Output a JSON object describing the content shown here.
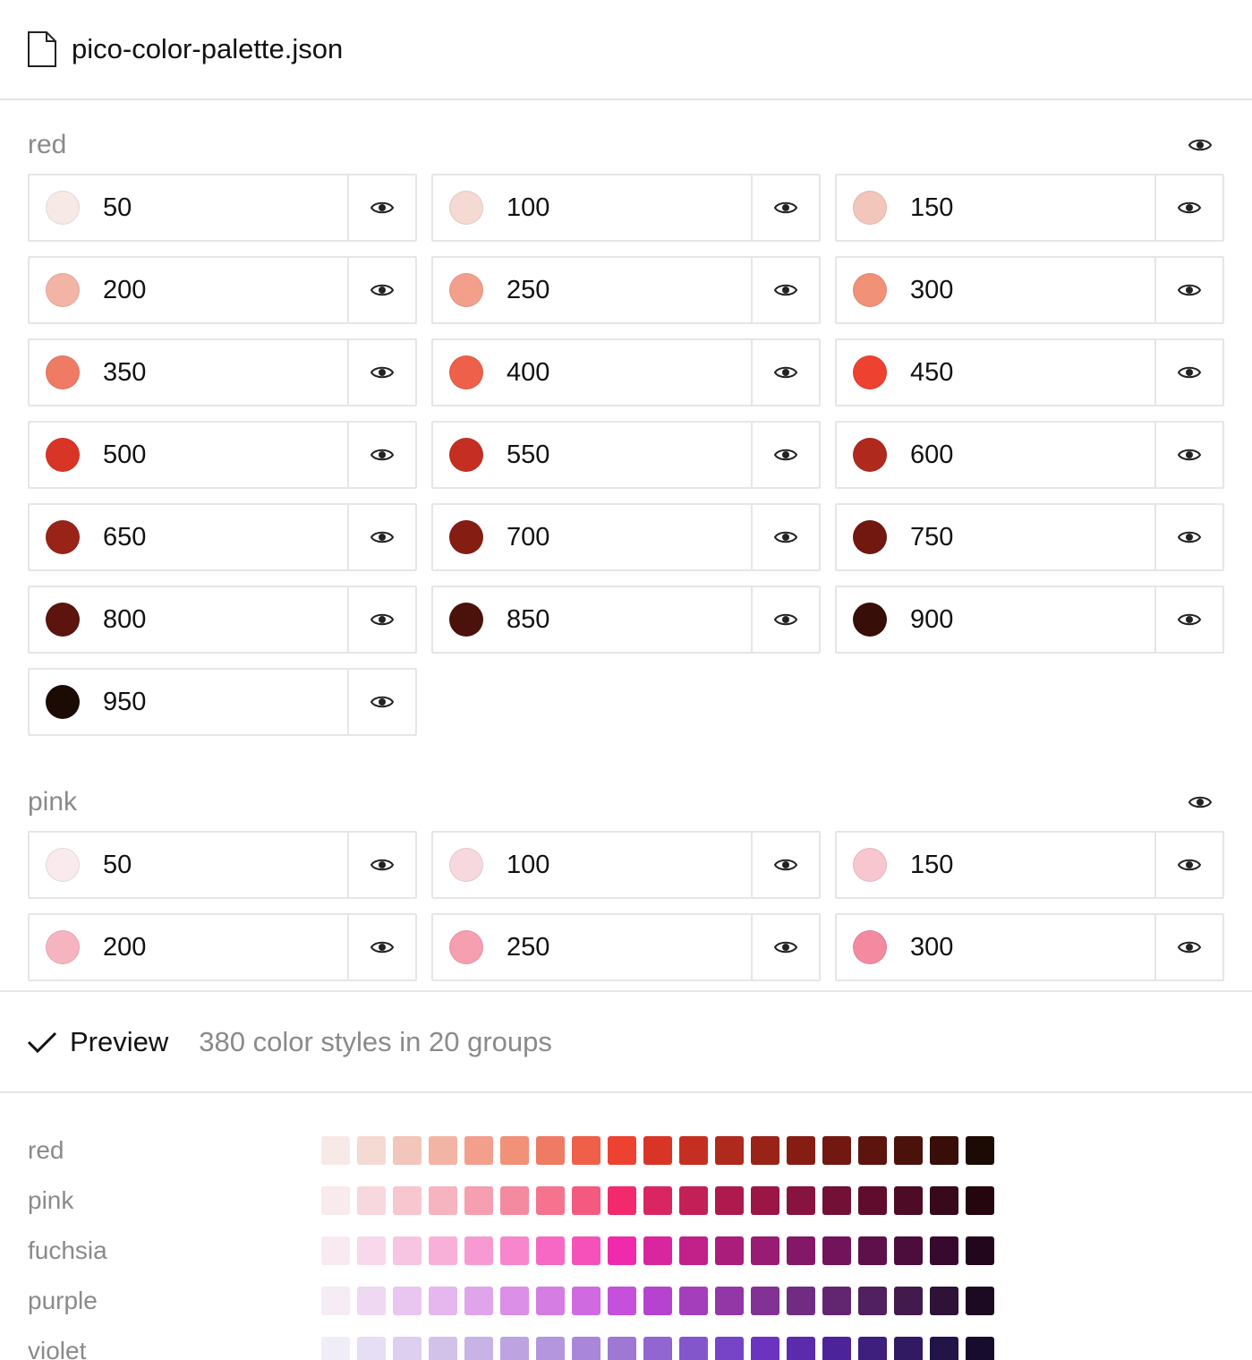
{
  "header": {
    "filename": "pico-color-palette.json",
    "icon": "file-icon"
  },
  "groups": [
    {
      "name": "red",
      "items": [
        {
          "label": "50",
          "color": "#f7eae6"
        },
        {
          "label": "100",
          "color": "#f5dad3"
        },
        {
          "label": "150",
          "color": "#f3c6bb"
        },
        {
          "label": "200",
          "color": "#f2b4a4"
        },
        {
          "label": "250",
          "color": "#f39f8b"
        },
        {
          "label": "300",
          "color": "#f19178"
        },
        {
          "label": "350",
          "color": "#ef7b64"
        },
        {
          "label": "400",
          "color": "#ee6049"
        },
        {
          "label": "450",
          "color": "#ee4231"
        },
        {
          "label": "500",
          "color": "#d93526"
        },
        {
          "label": "550",
          "color": "#c52f21"
        },
        {
          "label": "600",
          "color": "#af291d"
        },
        {
          "label": "650",
          "color": "#9a2318"
        },
        {
          "label": "700",
          "color": "#861d13"
        },
        {
          "label": "750",
          "color": "#721811"
        },
        {
          "label": "800",
          "color": "#5d140e"
        },
        {
          "label": "850",
          "color": "#4b120b"
        },
        {
          "label": "900",
          "color": "#380f08"
        },
        {
          "label": "950",
          "color": "#1c0b05"
        }
      ]
    },
    {
      "name": "pink",
      "items": [
        {
          "label": "50",
          "color": "#f9eaed"
        },
        {
          "label": "100",
          "color": "#f7d8de"
        },
        {
          "label": "150",
          "color": "#f7c6cf"
        },
        {
          "label": "200",
          "color": "#f6b4c0"
        },
        {
          "label": "250",
          "color": "#f59fb0"
        },
        {
          "label": "300",
          "color": "#f48aa0"
        }
      ]
    }
  ],
  "footer": {
    "preview_label": "Preview",
    "summary": "380 color styles in 20 groups"
  },
  "preview": [
    {
      "name": "red",
      "colors": [
        "#f7eae6",
        "#f5dad3",
        "#f3c6bb",
        "#f2b4a4",
        "#f39f8b",
        "#f19178",
        "#ef7b64",
        "#ee6049",
        "#ee4231",
        "#d93526",
        "#c52f21",
        "#af291d",
        "#9a2318",
        "#861d13",
        "#721811",
        "#5d140e",
        "#4b120b",
        "#380f08",
        "#1c0b05"
      ]
    },
    {
      "name": "pink",
      "colors": [
        "#f9eaed",
        "#f7d8de",
        "#f7c6cf",
        "#f6b4c0",
        "#f59fb0",
        "#f48aa0",
        "#f5738f",
        "#f45a7f",
        "#f22a6d",
        "#d92662",
        "#c42058",
        "#af1a4e",
        "#9b1645",
        "#871340",
        "#731036",
        "#600d2d",
        "#4e0b25",
        "#37091b",
        "#25060f"
      ]
    },
    {
      "name": "fuchsia",
      "colors": [
        "#f9eaf2",
        "#f8d8ea",
        "#f7c4e1",
        "#f8b0d8",
        "#f89ad2",
        "#f786cc",
        "#f768c4",
        "#f552b9",
        "#ef2aad",
        "#d9269e",
        "#c12189",
        "#aa1d7b",
        "#981b74",
        "#841767",
        "#72135b",
        "#5d1049",
        "#4c0d3c",
        "#38092e",
        "#22061c"
      ]
    },
    {
      "name": "purple",
      "colors": [
        "#f5ecf6",
        "#eed8f2",
        "#e9c6ef",
        "#e5b7ee",
        "#e0a4ea",
        "#db8fe6",
        "#d57de3",
        "#cf6ae0",
        "#c450dc",
        "#b543cf",
        "#a43ebb",
        "#9337a7",
        "#823194",
        "#712b83",
        "#622670",
        "#51205e",
        "#421a4d",
        "#2f1237",
        "#1c0a22"
      ]
    },
    {
      "name": "violet",
      "colors": [
        "#f0edf8",
        "#e6def4",
        "#ddcfef",
        "#d2c2ea",
        "#c8b3e6",
        "#bda4e1",
        "#b396dd",
        "#a986d9",
        "#9f77d5",
        "#9166d0",
        "#8456cb",
        "#7744c7",
        "#6c33c1",
        "#5c2bad",
        "#4c2399",
        "#3f1f7d",
        "#311a62",
        "#221448",
        "#170c2e"
      ]
    }
  ]
}
